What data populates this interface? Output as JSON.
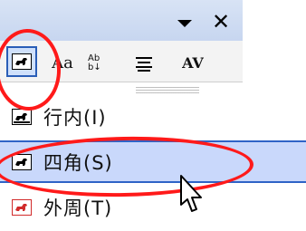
{
  "toolbar": {
    "items": [
      {
        "name": "wrap-style-button",
        "label": ""
      },
      {
        "name": "font-size-button",
        "label": "Aa"
      },
      {
        "name": "character-spacing-button",
        "label": "Ab\nb↓"
      },
      {
        "name": "align-button",
        "label": ""
      },
      {
        "name": "av-button",
        "label": "AV"
      }
    ]
  },
  "menu": {
    "items": [
      {
        "label": "行内(I)",
        "selected": false
      },
      {
        "label": "四角(S)",
        "selected": true
      },
      {
        "label": "外周(T)",
        "selected": false
      }
    ]
  },
  "colors": {
    "highlight": "#ff1a1a",
    "selection_border": "#2f63c7",
    "selection_fill": "#c9d8fb"
  }
}
